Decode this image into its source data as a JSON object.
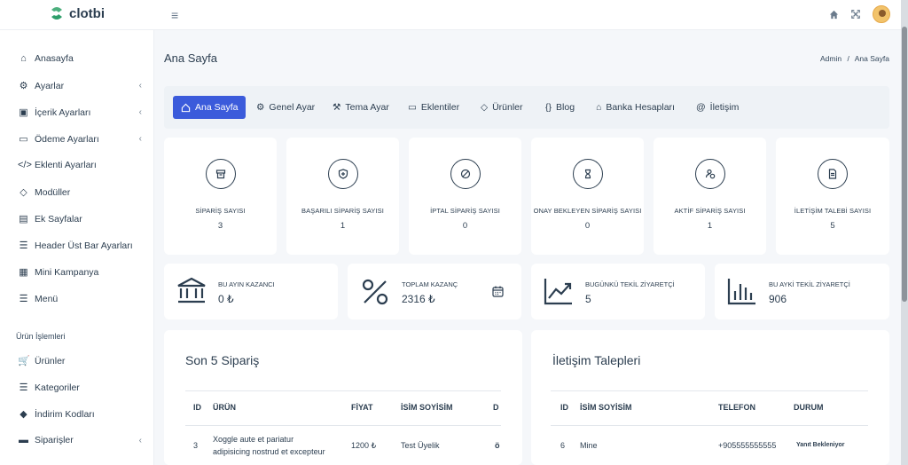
{
  "brand": {
    "name": "clotbi",
    "accent": "#3b5bdb"
  },
  "topbar": {
    "icons": [
      "home-icon",
      "fullscreen-icon"
    ]
  },
  "sidebar": {
    "items": [
      {
        "label": "Anasayfa",
        "icon": "home-icon",
        "chevron": false
      },
      {
        "label": "Ayarlar",
        "icon": "gears-icon",
        "chevron": true
      },
      {
        "label": "İçerik Ayarları",
        "icon": "id-card-icon",
        "chevron": true
      },
      {
        "label": "Ödeme Ayarları",
        "icon": "credit-card-icon",
        "chevron": true
      },
      {
        "label": "Eklenti Ayarları",
        "icon": "code-icon",
        "chevron": false
      },
      {
        "label": "Modüller",
        "icon": "diamond-icon",
        "chevron": false
      },
      {
        "label": "Ek Sayfalar",
        "icon": "contact-book-icon",
        "chevron": false
      },
      {
        "label": "Header Üst Bar Ayarları",
        "icon": "bars-icon",
        "chevron": false
      },
      {
        "label": "Mini Kampanya",
        "icon": "newspaper-icon",
        "chevron": false
      },
      {
        "label": "Menü",
        "icon": "list-icon",
        "chevron": false
      }
    ],
    "section_title": "Ürün İşlemleri",
    "items2": [
      {
        "label": "Ürünler",
        "icon": "cart-icon",
        "chevron": false
      },
      {
        "label": "Kategoriler",
        "icon": "list-icon",
        "chevron": false
      },
      {
        "label": "İndirim Kodları",
        "icon": "tag-icon",
        "chevron": false
      },
      {
        "label": "Siparişler",
        "icon": "briefcase-icon",
        "chevron": true
      }
    ]
  },
  "page": {
    "title": "Ana Sayfa",
    "breadcrumb": [
      "Admin",
      "Ana Sayfa"
    ],
    "breadcrumb_sep": "/"
  },
  "tabs": [
    {
      "label": "Ana Sayfa",
      "icon": "home-icon",
      "active": true
    },
    {
      "label": "Genel Ayar",
      "icon": "gear-icon",
      "active": false
    },
    {
      "label": "Tema Ayar",
      "icon": "magic-wand-icon",
      "active": false
    },
    {
      "label": "Eklentiler",
      "icon": "window-icon",
      "active": false
    },
    {
      "label": "Ürünler",
      "icon": "tag-icon",
      "active": false
    },
    {
      "label": "Blog",
      "icon": "braces-icon",
      "active": false
    },
    {
      "label": "Banka Hesapları",
      "icon": "bank-icon",
      "active": false
    },
    {
      "label": "İletişim",
      "icon": "at-icon",
      "active": false
    }
  ],
  "stats": [
    {
      "label": "SİPARİŞ SAYISI",
      "value": "3",
      "icon": "archive-icon"
    },
    {
      "label": "BAŞARILI SİPARİŞ SAYISI",
      "value": "1",
      "icon": "shield-plus-icon"
    },
    {
      "label": "İPTAL SİPARİŞ SAYISI",
      "value": "0",
      "icon": "ban-icon"
    },
    {
      "label": "ONAY BEKLEYEN SİPARİŞ SAYISI",
      "value": "0",
      "icon": "hourglass-icon"
    },
    {
      "label": "AKTİF SİPARİŞ SAYISI",
      "value": "1",
      "icon": "user-clock-icon"
    },
    {
      "label": "İLETİŞİM TALEBİ SAYISI",
      "value": "5",
      "icon": "document-icon"
    }
  ],
  "income": [
    {
      "label": "BU AYIN KAZANCI",
      "value": "0 ₺",
      "icon": "bank-icon"
    },
    {
      "label": "TOPLAM KAZANÇ",
      "value": "2316 ₺",
      "icon": "percent-icon",
      "extra_icon": "calendar-icon"
    },
    {
      "label": "BUGÜNKÜ TEKİL ZİYARETÇİ",
      "value": "5",
      "icon": "trend-up-icon"
    },
    {
      "label": "BU AYKİ TEKİL ZİYARETÇİ",
      "value": "906",
      "icon": "bar-chart-icon"
    }
  ],
  "orders": {
    "title": "Son 5 Sipariş",
    "columns": [
      "ID",
      "ÜRÜN",
      "FİYAT",
      "İSİM SOYİSİM",
      "D"
    ],
    "rows": [
      {
        "id": "3",
        "product_line1": "Xoggle aute et pariatur",
        "product_line2": "adipisicing nostrud et excepteur",
        "price": "1200 ₺",
        "name": "Test Üyelik",
        "status": "ö"
      }
    ]
  },
  "contacts": {
    "title": "İletişim Talepleri",
    "columns": [
      "ID",
      "İSİM SOYİSİM",
      "TELEFON",
      "DURUM"
    ],
    "rows": [
      {
        "id": "6",
        "name": "Mine",
        "phone": "+905555555555",
        "status": "Yanıt Bekleniyor"
      }
    ]
  }
}
